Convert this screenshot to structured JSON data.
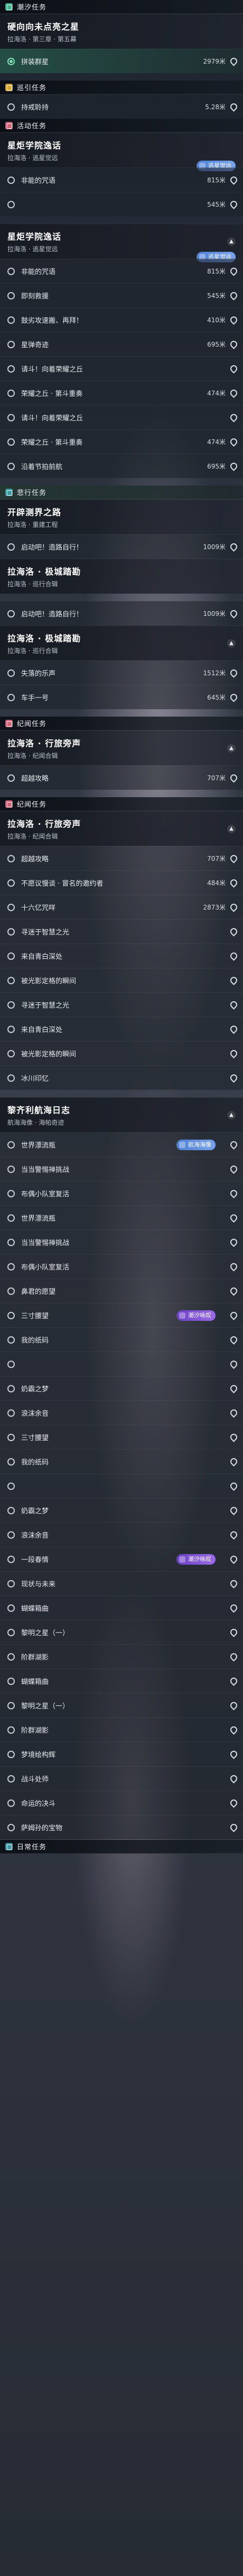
{
  "sections": [
    {
      "title": "潮汐任务",
      "icon": "teal-diamond",
      "color": "#43b38a"
    },
    {
      "title": "巡引任务",
      "icon": "gold-diamond",
      "color": "#d9a33a"
    },
    {
      "title": "活动任务",
      "icon": "rose-diamond",
      "color": "#d2647a"
    },
    {
      "title": "悲行任务",
      "icon": "teal-diamond",
      "color": "#3f9aa3"
    },
    {
      "title": "纪闻任务",
      "icon": "rose-diamond",
      "color": "#d2647a"
    },
    {
      "title": "纪闻任务",
      "icon": "rose-diamond",
      "color": "#d2647a"
    },
    {
      "title": "日常任务",
      "icon": "teal-diamond",
      "color": "#3f9aa3"
    }
  ],
  "quest_a": {
    "title": "硬向向未点亮之星",
    "sub": "拉海洛 · 第三章 · 第五幕"
  },
  "quest_a_rows": [
    {
      "label": "拼装群星",
      "dist": "2979米"
    }
  ],
  "guide_rows": [
    {
      "label": "持戒聆持",
      "dist": "5.28米"
    }
  ],
  "event_card": {
    "title": "星炬学院逸话",
    "sub": "拉海洛 · 逃星觉远",
    "badge": "逃星觉远"
  },
  "event_rows": [
    {
      "label": "非能的咒语",
      "dist": "815米"
    },
    {
      "label": "",
      "dist": "545米"
    }
  ],
  "event2_card": {
    "title": "星炬学院逸话",
    "sub": "拉海洛 · 逃星觉远",
    "badge": "逃星觉远"
  },
  "event2_rows": [
    {
      "label": "非能的咒语",
      "dist": "815米"
    },
    {
      "label": "即刻救援",
      "dist": "545米"
    },
    {
      "label": "鼓劣攻速搬、再拜！",
      "dist": "410米"
    },
    {
      "label": "星弹奇迹",
      "dist": "695米"
    },
    {
      "label": "请斗！向着荣耀之丘",
      "dist": ""
    },
    {
      "label": "荣耀之丘 · 第斗重奏",
      "dist": "474米"
    },
    {
      "label": "请斗！向着荣耀之丘",
      "dist": ""
    },
    {
      "label": "荣耀之丘 · 第斗重奏",
      "dist": "474米"
    },
    {
      "label": "沿着节拍前航",
      "dist": "695米"
    }
  ],
  "side_card": {
    "title": "开辟测界之路",
    "sub": "拉海洛 · 重建工程"
  },
  "side_rows": [
    {
      "label": "启动吧！造路自行！",
      "dist": "1009米"
    }
  ],
  "side2_card": {
    "title": "拉海洛 · 极城踏勘",
    "sub": "拉海洛 · 巡行合辑"
  },
  "side2_rows_pre": [
    {
      "label": "启动吧！造路自行！",
      "dist": "1009米"
    }
  ],
  "side3_card": {
    "title": "拉海洛 · 极城踏勘",
    "sub": "拉海洛 · 巡行合辑"
  },
  "side3_rows": [
    {
      "label": "失落的乐声",
      "dist": "1512米"
    },
    {
      "label": "车手一号",
      "dist": "645米"
    }
  ],
  "lore_card": {
    "title": "拉海洛 · 行旅旁声",
    "sub": "拉海洛 · 纪闻合辑"
  },
  "lore_rows": [
    {
      "label": "超越攻略",
      "dist": "707米"
    }
  ],
  "lore2_card": {
    "title": "拉海洛 · 行旅旁声",
    "sub": "拉海洛 · 纪闻合辑"
  },
  "lore2_rows": [
    {
      "label": "超越攻略",
      "dist": "707米"
    },
    {
      "label": "不愿议慢谈 · 冒名的邀约者",
      "dist": "484米"
    },
    {
      "label": "十六亿咒咩",
      "dist": "2873米"
    },
    {
      "label": "寻迷于智慧之光",
      "dist": ""
    },
    {
      "label": "来自青白深处",
      "dist": ""
    },
    {
      "label": "被光影定格的瞬间",
      "dist": ""
    },
    {
      "label": "寻迷于智慧之光",
      "dist": ""
    },
    {
      "label": "来自青白深处",
      "dist": ""
    },
    {
      "label": "被光影定格的瞬间",
      "dist": ""
    },
    {
      "label": "冰川印忆",
      "dist": ""
    }
  ],
  "voyage_card": {
    "title": "黎齐利航海日志",
    "sub": "航海海像 · 海帕奇迹"
  },
  "voyage_rows": [
    {
      "label": "世界漂流瓶",
      "dist": "",
      "badge": "航海海像"
    },
    {
      "label": "当当警惕禅挑战",
      "dist": ""
    },
    {
      "label": "布偶小队室复活",
      "dist": ""
    },
    {
      "label": "世界漂流瓶",
      "dist": ""
    },
    {
      "label": "当当警惕禅挑战",
      "dist": ""
    },
    {
      "label": "布偶小队室复活",
      "dist": ""
    },
    {
      "label": "鼻君的愿望",
      "dist": ""
    },
    {
      "label": "三寸腰望",
      "dist": "",
      "badge": "潮汐咏叹"
    },
    {
      "label": "我的纸码",
      "dist": ""
    },
    {
      "label": "",
      "dist": ""
    },
    {
      "label": "奶霸之梦",
      "dist": ""
    },
    {
      "label": "浪沫余音",
      "dist": ""
    },
    {
      "label": "三寸腰望",
      "dist": ""
    },
    {
      "label": "我的纸码",
      "dist": ""
    },
    {
      "label": "",
      "dist": ""
    },
    {
      "label": "奶霸之梦",
      "dist": ""
    },
    {
      "label": "浪沫余音",
      "dist": ""
    },
    {
      "label": "一段春情",
      "dist": "",
      "badge": "潮汐咏叹"
    },
    {
      "label": "现状与未来",
      "dist": ""
    },
    {
      "label": "蝴蝶箱曲",
      "dist": ""
    },
    {
      "label": "黎明之星（一）",
      "dist": ""
    },
    {
      "label": "阶群湖影",
      "dist": ""
    },
    {
      "label": "蝴蝶箱曲",
      "dist": ""
    },
    {
      "label": "黎明之星（一）",
      "dist": ""
    },
    {
      "label": "阶群湖影",
      "dist": ""
    },
    {
      "label": "梦境绘构辉",
      "dist": ""
    },
    {
      "label": "战斗处师",
      "dist": ""
    },
    {
      "label": "命运的决斗",
      "dist": ""
    },
    {
      "label": "萨姆孙的宝物",
      "dist": ""
    }
  ]
}
